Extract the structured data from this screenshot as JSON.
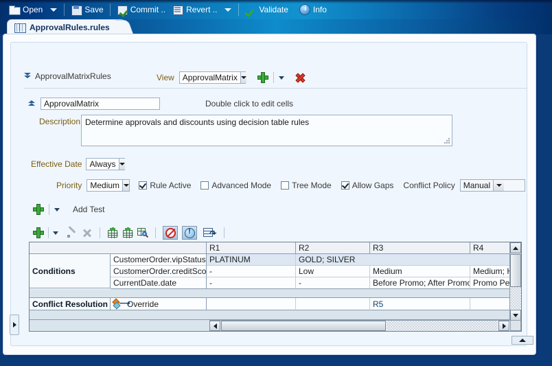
{
  "toolbar": {
    "items": [
      {
        "label": "Open",
        "icon": "folder-open-icon",
        "has_caret": true
      },
      {
        "label": "Save",
        "icon": "save-floppy-icon",
        "has_caret": false
      },
      {
        "label": "Commit ..",
        "icon": "commit-icon",
        "has_caret": false
      },
      {
        "label": "Revert ..",
        "icon": "revert-icon",
        "has_caret": true
      },
      {
        "label": "Validate",
        "icon": "validate-check-icon",
        "has_caret": false
      },
      {
        "label": "Info",
        "icon": "info-icon",
        "has_caret": false
      }
    ]
  },
  "tab": {
    "label": "ApprovalRules.rules",
    "icon": "ruleset-book-icon"
  },
  "ruleset": {
    "title": "ApprovalMatrixRules",
    "view_label": "View",
    "view_value": "ApprovalMatrix",
    "add_view_icon": "add-green-plus-icon",
    "delete_view_icon": "delete-red-x-icon"
  },
  "table_header": {
    "name_value": "ApprovalMatrix",
    "hint": "Double click to edit cells",
    "description_label": "Description",
    "description_value": "Determine approvals and discounts using decision table rules"
  },
  "options": {
    "effective_date_label": "Effective Date",
    "effective_date_value": "Always",
    "priority_label": "Priority",
    "priority_value": "Medium",
    "rule_active_label": "Rule Active",
    "rule_active_checked": true,
    "advanced_mode_label": "Advanced Mode",
    "advanced_mode_checked": false,
    "tree_mode_label": "Tree Mode",
    "tree_mode_checked": false,
    "allow_gaps_label": "Allow Gaps",
    "allow_gaps_checked": true,
    "conflict_policy_label": "Conflict Policy",
    "conflict_policy_value": "Manual"
  },
  "add_test": {
    "label": "Add Test"
  },
  "grid_toolbar": {
    "buttons": [
      {
        "name": "add-row-button",
        "icon": "green-plus-icon"
      },
      {
        "name": "add-row-dropdown",
        "icon": "caret-down-icon"
      },
      {
        "name": "edit-button",
        "icon": "pencil-icon"
      },
      {
        "name": "delete-button",
        "icon": "grey-x-icon"
      },
      {
        "name": "insert-column-button",
        "icon": "table-add-column-icon"
      },
      {
        "name": "split-column-button",
        "icon": "table-split-column-icon"
      },
      {
        "name": "find-gaps-button",
        "icon": "table-search-icon"
      },
      {
        "name": "toggle-conflicts-button",
        "icon": "no-entry-icon"
      },
      {
        "name": "toggle-warnings-button",
        "icon": "exclamation-icon"
      },
      {
        "name": "compact-table-button",
        "icon": "table-arrow-icon"
      }
    ]
  },
  "decision_table": {
    "rule_columns": [
      "R1",
      "R2",
      "R3",
      "R4"
    ],
    "conditions_label": "Conditions",
    "conditions": [
      {
        "expression": "CustomerOrder.vipStatus",
        "values": [
          "PLATINUM",
          "GOLD; SILVER",
          "",
          ""
        ],
        "highlighted": true
      },
      {
        "expression": "CustomerOrder.creditScore",
        "values": [
          "-",
          "Low",
          "Medium",
          "Medium; High"
        ],
        "highlighted": false
      },
      {
        "expression": "CurrentDate.date",
        "values": [
          "-",
          "-",
          "Before Promo; After Promo",
          "Promo Period"
        ],
        "highlighted": false
      }
    ],
    "conflict_resolution_label": "Conflict Resolution",
    "conflict_resolution_value": "Override",
    "conflict_resolution_icon": "override-icon",
    "conflict_resolution_cells": [
      "",
      "",
      "",
      "R5"
    ]
  }
}
